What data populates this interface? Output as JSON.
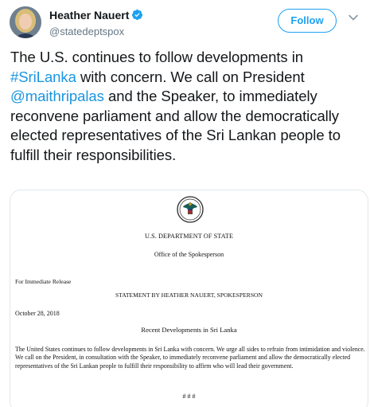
{
  "tweet": {
    "display_name": "Heather Nauert",
    "handle": "@statedeptspox",
    "follow_label": "Follow",
    "text_parts": {
      "p1": "The U.S. continues to follow developments in ",
      "hashtag": "#SriLanka",
      "p2": " with concern. We call on President ",
      "mention": "@maithripalas",
      "p3": " and the Speaker, to immediately reconvene parliament and allow the democratically elected representatives of the Sri Lankan people to fulfill their responsibilities."
    }
  },
  "document": {
    "department": "U.S. DEPARTMENT OF STATE",
    "office": "Office of the Spokesperson",
    "release": "For Immediate Release",
    "statement": "STATEMENT BY HEATHER NAUERT, SPOKESPERSON",
    "date": "October 28, 2018",
    "subject": "Recent Developments in Sri Lanka",
    "body": "The United States continues to follow developments in Sri Lanka with concern.  We urge all sides to refrain from intimidation and violence.  We call on the President, in consultation with the Speaker, to immediately reconvene parliament and allow the democratically elected representatives of the Sri Lankan people to fulfill their responsibility to affirm who will lead their government.",
    "end_mark": "# # #"
  },
  "colors": {
    "link": "#1b95e0",
    "follow_accent": "#1da1f2",
    "verified": "#1da1f2",
    "secondary_text": "#657786"
  },
  "icons": [
    "verified-badge-icon",
    "chevron-down-icon",
    "state-department-seal-icon"
  ]
}
